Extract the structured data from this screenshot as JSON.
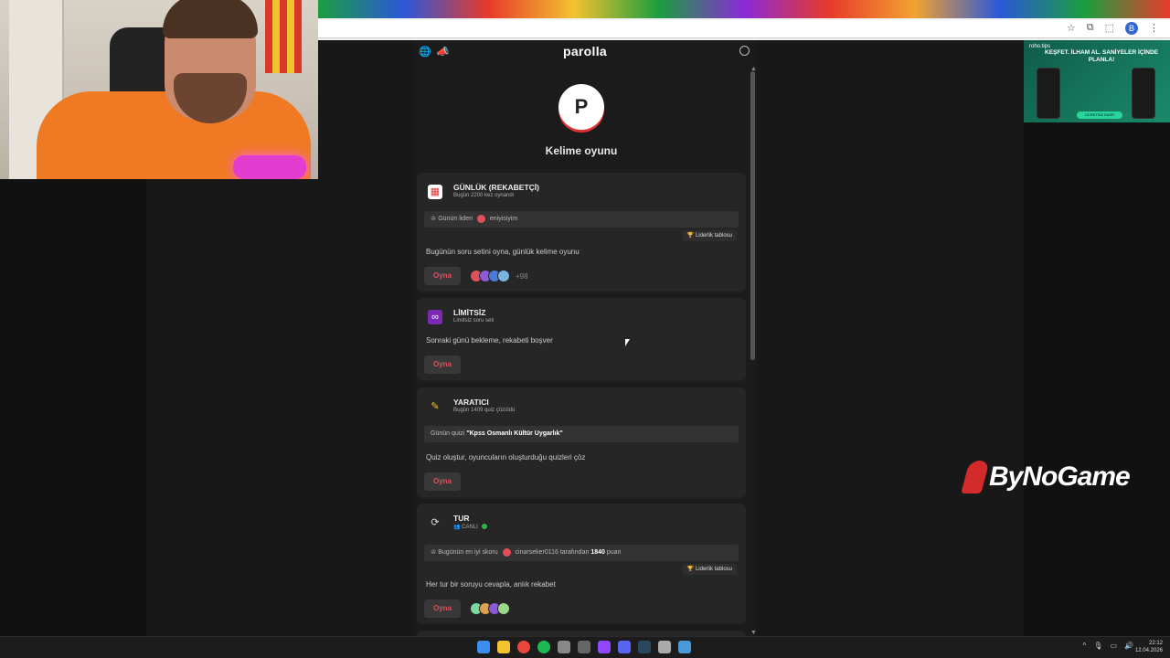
{
  "app": {
    "title": "parolla",
    "logo_letter": "P",
    "subtitle": "Kelime oyunu"
  },
  "cards": [
    {
      "title": "GÜNLÜK (REKABETÇİ)",
      "subtitle": "Bugün 2200 kez oynandı",
      "info_prefix": "Günün lideri",
      "info_user": "eniyisiyim",
      "leader_button": "🏆 Liderlik tablosu",
      "description": "Bugünün soru setini oyna, günlük kelime oyunu",
      "play_label": "Oyna",
      "more_players": "+98"
    },
    {
      "title": "LİMİTSİZ",
      "subtitle": "Limitsiz soru seti",
      "description": "Sonraki günü bekleme, rekabeti boşver",
      "play_label": "Oyna"
    },
    {
      "title": "YARATICI",
      "subtitle": "Bugün 1409 quiz çözüldü",
      "info_prefix": "Günün quizi",
      "info_quiz": "\"Kpss Osmanlı Kültür Uygarlık\"",
      "description": "Quiz oluştur, oyuncuların oluşturduğu quizleri çöz",
      "play_label": "Oyna"
    },
    {
      "title": "TUR",
      "subtitle": "CANLI",
      "info_prefix": "Bugünün en iyi skoru",
      "info_user": "cinarseker0116",
      "info_mid": "tarafından",
      "info_score": "1840",
      "info_suffix": "puan",
      "leader_button": "🏆 Liderlik tablosu",
      "description": "Her tur bir soruyu cevapla, anlık rekabet",
      "play_label": "Oyna"
    }
  ],
  "ad": {
    "brand": "roho.tips",
    "headline": "KEŞFET. İLHAM AL. SANİYELER İÇİNDE PLANLA!",
    "cta": "ÜCRETSİZ İNDİR"
  },
  "watermark": "ByNoGame",
  "taskbar": {
    "time": "22:12",
    "date": "12.04.2026"
  },
  "browser": {
    "profile_letter": "B"
  },
  "colors": {
    "accent": "#e0505a",
    "card_bg": "#262626",
    "page_bg": "#1b1b1b"
  }
}
